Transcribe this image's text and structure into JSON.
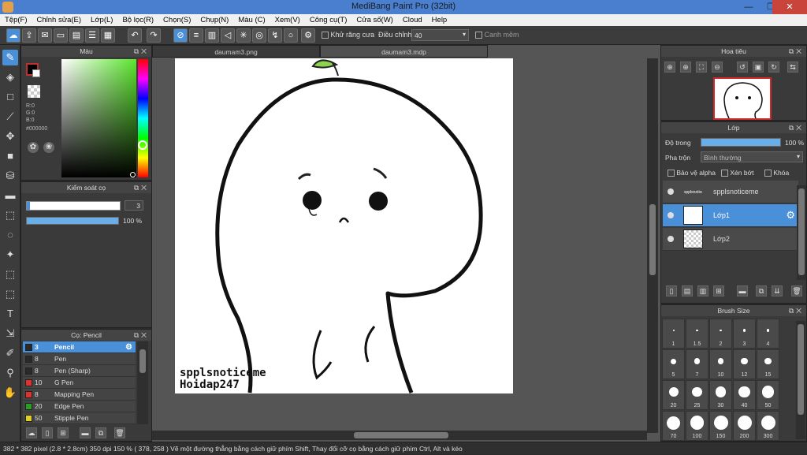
{
  "window": {
    "title": "MediBang Paint Pro (32bit)",
    "min": "—",
    "max": "❐",
    "close": "✕"
  },
  "menu": [
    "Tệp(F)",
    "Chỉnh sửa(E)",
    "Lớp(L)",
    "Bộ lọc(R)",
    "Chọn(S)",
    "Chụp(N)",
    "Màu (C)",
    "Xem(V)",
    "Công cụ(T)",
    "Cửa số(W)",
    "Cloud",
    "Help"
  ],
  "toolbar": {
    "antialias_label": "Khử răng cưa",
    "adjust_label": "Điều chỉnh",
    "adjust_value": "40",
    "edge_label": "Canh mềm"
  },
  "color_panel": {
    "title": "Màu",
    "r": "R:0",
    "g": "G:0",
    "b": "B:0",
    "hex": "#000000",
    "fg_color": "#000000",
    "bg_color": "#ffffff"
  },
  "brush_control": {
    "title": "Kiểm soát cọ",
    "size": "3",
    "opacity": "100 %",
    "opacity_fraction": 1.0
  },
  "brush_panel": {
    "title": "Cọ: Pencil",
    "items": [
      {
        "size": "3",
        "name": "Pencil",
        "color": "#2a2a2a",
        "selected": true
      },
      {
        "size": "8",
        "name": "Pen",
        "color": "#2a2a2a"
      },
      {
        "size": "8",
        "name": "Pen (Sharp)",
        "color": "#2a2a2a"
      },
      {
        "size": "10",
        "name": "G Pen",
        "color": "#e03030"
      },
      {
        "size": "8",
        "name": "Mapping Pen",
        "color": "#e03030"
      },
      {
        "size": "20",
        "name": "Edge Pen",
        "color": "#28a028"
      },
      {
        "size": "50",
        "name": "Stipple Pen",
        "color": "#e0d020"
      }
    ]
  },
  "tabs": [
    {
      "label": "daumam3.png"
    },
    {
      "label": "daumam3.mdp",
      "active": true
    }
  ],
  "canvas": {
    "watermark_line1": "spplsnoticeme",
    "watermark_line2": "Hoidap247"
  },
  "navigator": {
    "title": "Hoa tiêu"
  },
  "layer_panel": {
    "title": "Lớp",
    "opacity_label": "Độ trong",
    "opacity_value": "100 %",
    "opacity_fraction": 1.0,
    "blend_label": "Pha trộn",
    "blend_value": "Bình thường",
    "protect_alpha": "Bảo vệ alpha",
    "clipping": "Xén bớt",
    "lock": "Khóa",
    "layers": [
      {
        "name": "spplsnoticeme"
      },
      {
        "name": "Lớp1",
        "selected": true
      },
      {
        "name": "Lớp2"
      }
    ]
  },
  "brush_size": {
    "title": "Brush Size",
    "sizes": [
      "1",
      "1.5",
      "2",
      "3",
      "4",
      "5",
      "7",
      "10",
      "12",
      "15",
      "20",
      "25",
      "30",
      "40",
      "50",
      "70",
      "100",
      "150",
      "200",
      "300"
    ]
  },
  "status": "382 * 382 pixel   (2.8 * 2.8cm)   350 dpi   150 %   ( 378, 258 )   Vẽ một đường thẳng bằng cách giữ phím Shift, Thay đổi cỡ cọ bằng cách giữ phím Ctrl, Alt và kéo"
}
